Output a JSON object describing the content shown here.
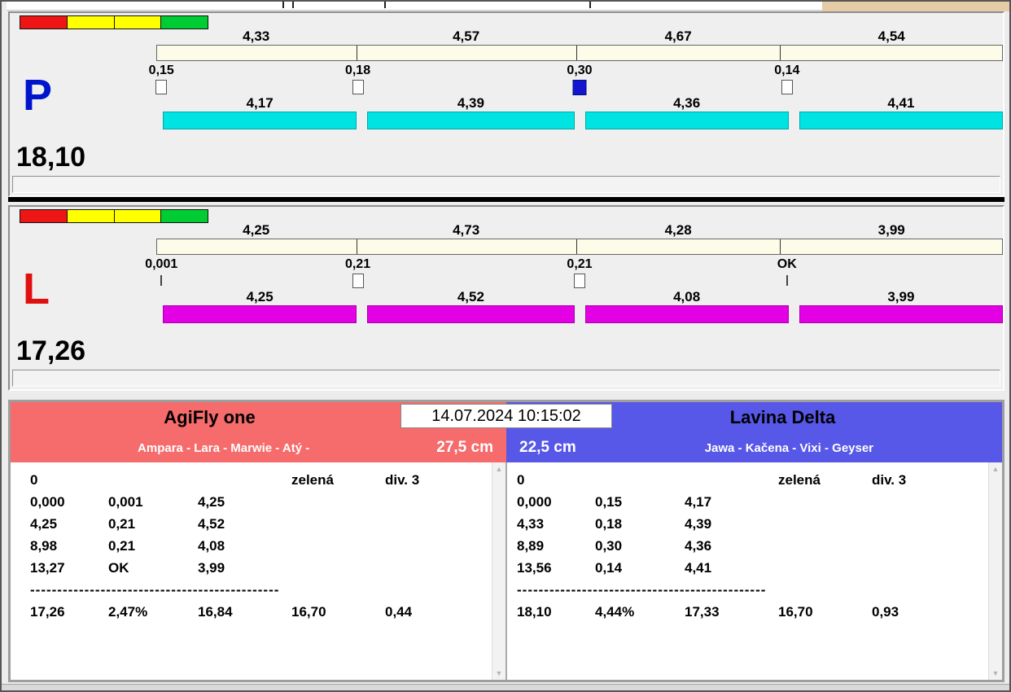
{
  "datetime": "14.07.2024 10:15:02",
  "sections": [
    {
      "letter": "P",
      "letter_color": "#0014cc",
      "total": "18,10",
      "top_values": [
        "4,33",
        "4,57",
        "4,67",
        "4,54"
      ],
      "split_values": [
        "0,15",
        "0,18",
        "0,30",
        "0,14"
      ],
      "split_markers": [
        "square",
        "square",
        "square-filled",
        "square"
      ],
      "bar_values": [
        "4,17",
        "4,39",
        "4,36",
        "4,41"
      ],
      "bar_color": "#00e3e3"
    },
    {
      "letter": "L",
      "letter_color": "#e01010",
      "total": "17,26",
      "top_values": [
        "4,25",
        "4,73",
        "4,28",
        "3,99"
      ],
      "split_values": [
        "0,001",
        "0,21",
        "0,21",
        "OK"
      ],
      "split_markers": [
        "tick",
        "square",
        "square",
        "tick"
      ],
      "bar_values": [
        "4,25",
        "4,52",
        "4,08",
        "3,99"
      ],
      "bar_color": "#e400e4"
    }
  ],
  "teams": [
    {
      "name": "AgiFly one",
      "members": "Ampara - Lara - Marwie - Atý -",
      "jump_height": "27,5 cm",
      "header_color": "#f66b6b",
      "rows": [
        [
          "0",
          "",
          "",
          "zelená",
          "div. 3"
        ],
        [
          "0,000",
          "0,001",
          "4,25",
          "",
          ""
        ],
        [
          "4,25",
          "0,21",
          "4,52",
          "",
          ""
        ],
        [
          "8,98",
          "0,21",
          "4,08",
          "",
          ""
        ],
        [
          "13,27",
          "OK",
          "3,99",
          "",
          ""
        ]
      ],
      "separator": "----------------------------------------------",
      "total_row": [
        "17,26",
        "2,47%",
        "16,84",
        "16,70",
        "0,44"
      ]
    },
    {
      "name": "Lavina Delta",
      "members": "Jawa - Kačena - Vixi - Geyser",
      "jump_height": "22,5 cm",
      "header_color": "#5757e8",
      "rows": [
        [
          "0",
          "",
          "",
          "zelená",
          "div. 3"
        ],
        [
          "0,000",
          "0,15",
          "4,17",
          "",
          ""
        ],
        [
          "4,33",
          "0,18",
          "4,39",
          "",
          ""
        ],
        [
          "8,89",
          "0,30",
          "4,36",
          "",
          ""
        ],
        [
          "13,56",
          "0,14",
          "4,41",
          "",
          ""
        ]
      ],
      "separator": "----------------------------------------------",
      "total_row": [
        "18,10",
        "4,44%",
        "17,33",
        "16,70",
        "0,93"
      ]
    }
  ],
  "colors": {
    "traffic": [
      "#ee1515",
      "#ffff00",
      "#ffff00",
      "#00cc33"
    ],
    "beige_corner": "#e5cba6"
  }
}
